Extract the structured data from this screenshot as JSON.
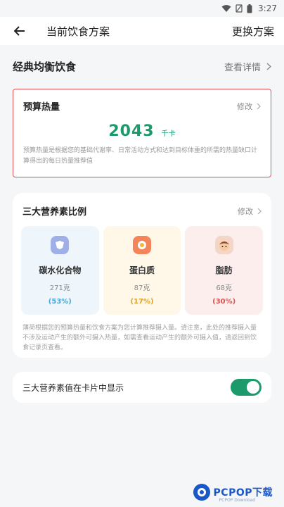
{
  "status_bar": {
    "time": "3:27"
  },
  "app_bar": {
    "title": "当前饮食方案",
    "switch_label": "更换方案"
  },
  "plan": {
    "name": "经典均衡饮食",
    "detail_label": "查看详情"
  },
  "budget": {
    "label": "预算热量",
    "edit_label": "修改",
    "value": "2043",
    "unit": "千卡",
    "description": "预算热量是根据您的基础代谢率、日常活动方式和达到目标体重的所需的热量缺口计算得出的每日热量推荐值"
  },
  "macros": {
    "label": "三大营养素比例",
    "edit_label": "修改",
    "items": [
      {
        "name": "碳水化合物",
        "grams": "271克",
        "pct": "(53%)",
        "color": "#4aa6d8",
        "bg": "#eef6fc"
      },
      {
        "name": "蛋白质",
        "grams": "87克",
        "pct": "(17%)",
        "color": "#e0a020",
        "bg": "#fff8e8"
      },
      {
        "name": "脂肪",
        "grams": "68克",
        "pct": "(30%)",
        "color": "#e05050",
        "bg": "#fdeeee"
      }
    ],
    "description": "薄荷根据您的预算热量和饮食方案为您计算推荐摄入量。请注意，此处的推荐摄入量不涉及运动产生的额外可摄入热量，如需查看运动产生的额外可摄入值，请返回到饮食记录页查看。"
  },
  "toggle": {
    "label": "三大营养素值在卡片中显示",
    "on": true
  },
  "watermark": {
    "text": "PCPOP下载",
    "sub": "PCPOP Download"
  },
  "colors": {
    "accent": "#1c9a6b",
    "highlight_border": "#e05050"
  }
}
